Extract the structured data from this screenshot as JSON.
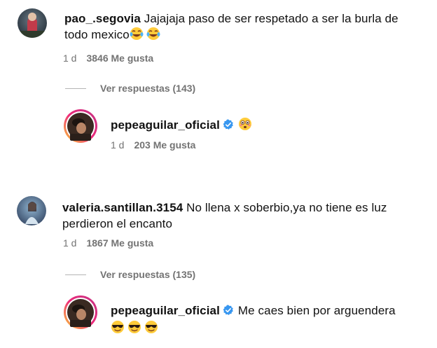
{
  "comments": [
    {
      "username": "pao_.segovia",
      "text_line1": "Jajajaja paso de ser respetado a ser la burla de",
      "text_line2": "todo mexico",
      "emojis": [
        "laughing-crying-emoji",
        "laughing-crying-emoji"
      ],
      "time": "1 d",
      "likes": "3846 Me gusta",
      "view_replies": "Ver respuestas (143)",
      "reply": {
        "username": "pepeaguilar_oficial",
        "text": "",
        "emojis": [
          "flushed-face-emoji"
        ],
        "time": "1 d",
        "likes": "203 Me gusta"
      }
    },
    {
      "username": "valeria.santillan.3154",
      "text_line1": "No llena x soberbio,ya no tiene es luz",
      "text_line2": "perdieron el encanto",
      "time": "1 d",
      "likes": "1867 Me gusta",
      "view_replies": "Ver respuestas (135)",
      "reply": {
        "username": "pepeaguilar_oficial",
        "text": "Me caes bien por arguendera",
        "emojis": [
          "sunglasses-emoji",
          "sunglasses-emoji",
          "sunglasses-emoji"
        ]
      }
    }
  ],
  "colors": {
    "text": "#111111",
    "meta": "#737373",
    "verified_badge": "#3897f0",
    "story_ring_start": "#f9ce34",
    "story_ring_end": "#c13584"
  }
}
